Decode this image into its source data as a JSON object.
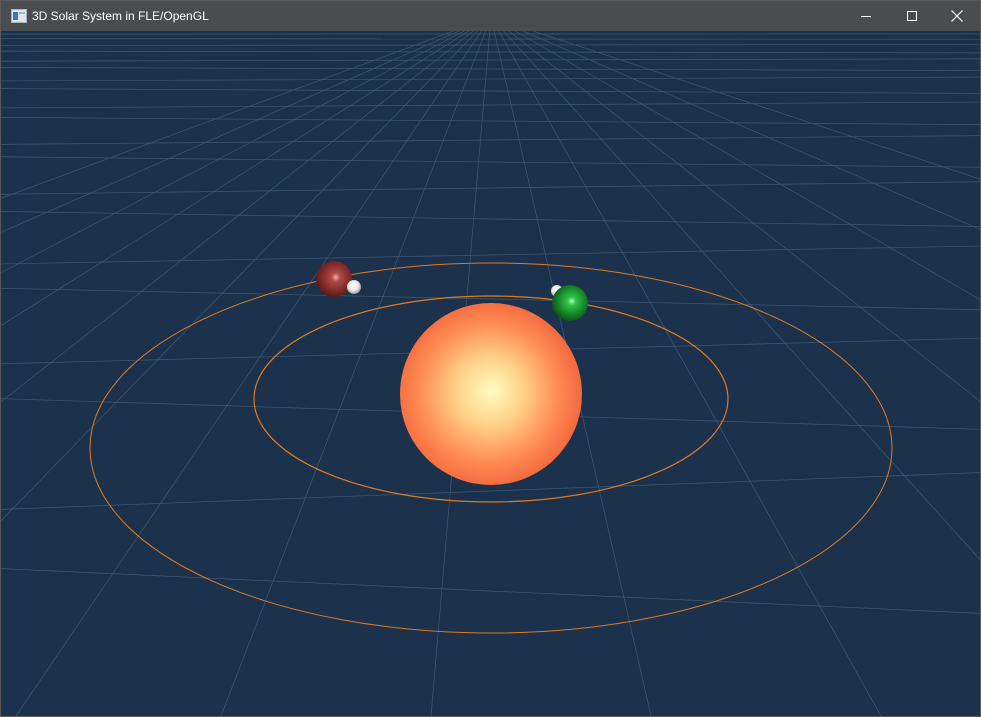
{
  "window": {
    "title": "3D Solar System in FLE/OpenGL",
    "icon": "app-window-icon",
    "controls": {
      "minimize": "minimize-icon",
      "maximize": "maximize-icon",
      "close": "close-icon"
    }
  },
  "scene": {
    "background_color": "#1c324c",
    "grid_color": "#4c6a86",
    "orbit_color": "#e07b20",
    "bodies": [
      {
        "name": "sun",
        "color": "#ff7a45",
        "highlight": "#fffdc0"
      },
      {
        "name": "planet-red",
        "color": "#8a2e2e",
        "highlight": "#e89a9a"
      },
      {
        "name": "moon-white-1",
        "color": "#dcdcdc",
        "highlight": "#ffffff"
      },
      {
        "name": "planet-green",
        "color": "#1a8a2a",
        "highlight": "#7dff8a"
      },
      {
        "name": "moon-white-2",
        "color": "#dcdcdc",
        "highlight": "#ffffff"
      }
    ]
  }
}
